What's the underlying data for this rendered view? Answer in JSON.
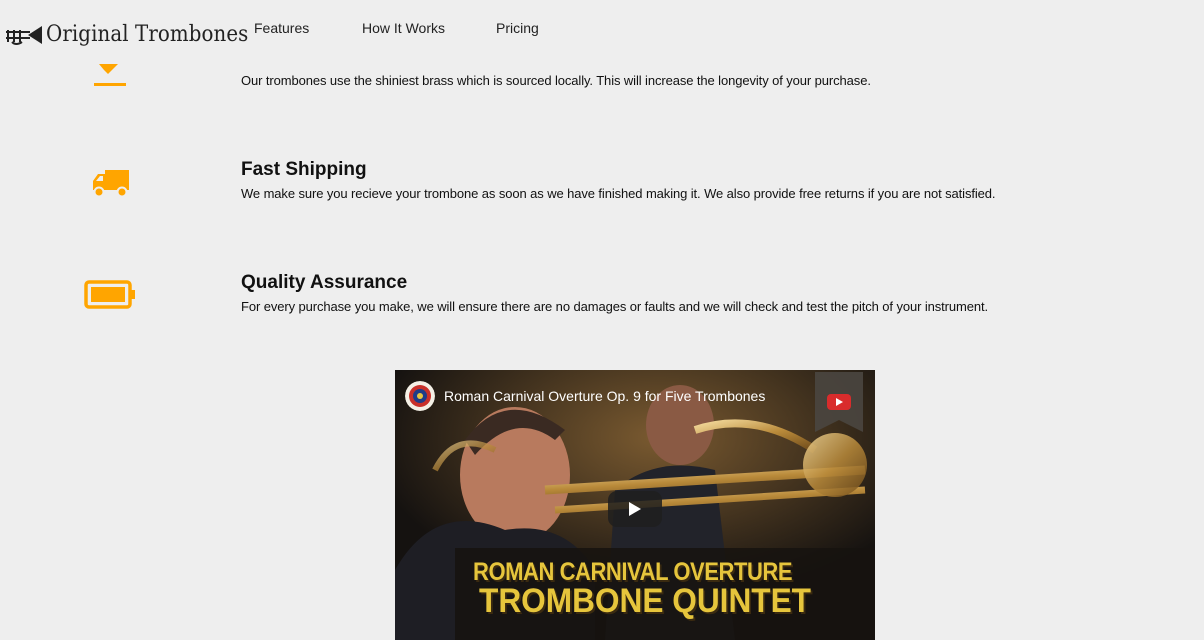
{
  "header": {
    "logo_text": "Original Trombones",
    "logo_icon": "trombone-icon",
    "nav": [
      {
        "label": "Features"
      },
      {
        "label": "How It Works"
      },
      {
        "label": "Pricing"
      }
    ]
  },
  "features": [
    {
      "icon": "brass-icon",
      "title": "",
      "description": "Our trombones use the shiniest brass which is sourced locally. This will increase the longevity of your purchase."
    },
    {
      "icon": "truck-icon",
      "title": "Fast Shipping",
      "description": "We make sure you recieve your trombone as soon as we have finished making it. We also provide free returns if you are not satisfied."
    },
    {
      "icon": "battery-icon",
      "title": "Quality Assurance",
      "description": "For every purchase you make, we will ensure there are no damages or faults and we will check and test the pitch of your instrument."
    }
  ],
  "video": {
    "title": "Roman Carnival Overture Op. 9 for Five Trombones",
    "overlay_line1": "ROMAN CARNIVAL OVERTURE",
    "overlay_line2": "TROMBONE QUINTET"
  },
  "colors": {
    "accent": "#ffa500",
    "background": "#eeeeee",
    "overlay_text": "#e6c53c"
  }
}
